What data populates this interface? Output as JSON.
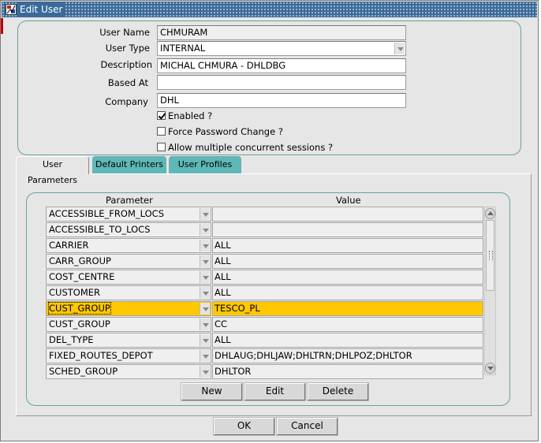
{
  "window": {
    "title": "Edit User"
  },
  "form": {
    "user_name_label": "User Name",
    "user_name": "CHMURAM",
    "user_type_label": "User Type",
    "user_type": "INTERNAL",
    "description_label": "Description",
    "description": "MICHAL CHMURA - DHLDBG",
    "based_at_label": "Based At",
    "based_at": "",
    "company_label": "Company",
    "company": "DHL",
    "enabled_label": "Enabled ?",
    "enabled": true,
    "force_pw_label": "Force Password Change ?",
    "force_pw": false,
    "multi_session_label": "Allow multiple concurrent sessions ?",
    "multi_session": false
  },
  "tabs": [
    {
      "label": "User Parameters",
      "active": true
    },
    {
      "label": "Default Printers",
      "active": false
    },
    {
      "label": "User Profiles",
      "active": false
    }
  ],
  "params": {
    "header_parameter": "Parameter",
    "header_value": "Value",
    "rows": [
      {
        "parameter": "ACCESSIBLE_FROM_LOCS",
        "value": ""
      },
      {
        "parameter": "ACCESSIBLE_TO_LOCS",
        "value": ""
      },
      {
        "parameter": "CARRIER",
        "value": "ALL"
      },
      {
        "parameter": "CARR_GROUP",
        "value": "ALL"
      },
      {
        "parameter": "COST_CENTRE",
        "value": "ALL"
      },
      {
        "parameter": "CUSTOMER",
        "value": "ALL"
      },
      {
        "parameter": "CUST_GROUP",
        "value": "TESCO_PL",
        "selected": true
      },
      {
        "parameter": "CUST_GROUP",
        "value": "CC"
      },
      {
        "parameter": "DEL_TYPE",
        "value": "ALL"
      },
      {
        "parameter": "FIXED_ROUTES_DEPOT",
        "value": "DHLAUG;DHLJAW;DHLTRN;DHLPOZ;DHLTOR"
      },
      {
        "parameter": "SCHED_GROUP",
        "value": "DHLTOR"
      }
    ],
    "new_label": "New",
    "edit_label": "Edit",
    "delete_label": "Delete"
  },
  "footer": {
    "ok_label": "OK",
    "cancel_label": "Cancel"
  },
  "colors": {
    "selection": "#ffc800",
    "tab_inactive": "#5fb8b8",
    "title_bar": "#3a6a9a"
  },
  "icons": [
    "app-icon",
    "dropdown-arrow-icon",
    "checkbox-icon",
    "scroll-up-icon",
    "scroll-down-icon"
  ]
}
